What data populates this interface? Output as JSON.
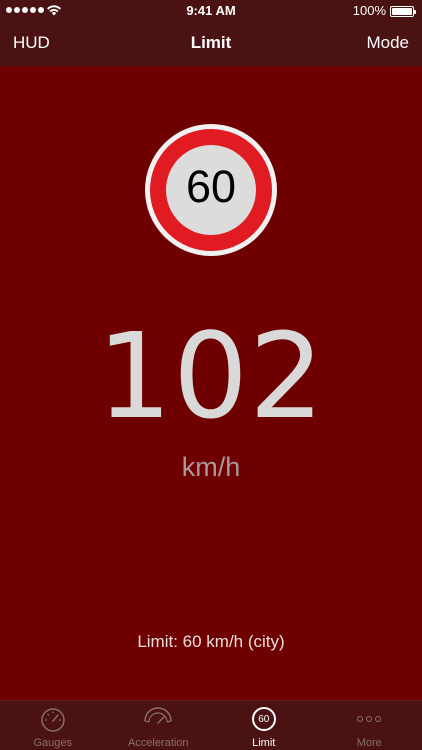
{
  "status_bar": {
    "time": "9:41 AM",
    "battery": "100%"
  },
  "nav": {
    "left": "HUD",
    "title": "Limit",
    "right": "Mode"
  },
  "main": {
    "sign_limit": "60",
    "speed": "102",
    "unit": "km/h",
    "limit_text": "Limit: 60 km/h (city)"
  },
  "tabs": [
    {
      "label": "Gauges",
      "icon": "gauge-icon",
      "active": false
    },
    {
      "label": "Acceleration",
      "icon": "acceleration-icon",
      "active": false
    },
    {
      "label": "Limit",
      "icon": "speed-limit-icon",
      "active": true,
      "icon_text": "60"
    },
    {
      "label": "More",
      "icon": "more-icon",
      "active": false
    }
  ],
  "colors": {
    "background": "#6e0000",
    "bars": "#4a1212",
    "sign_red": "#e01b22"
  }
}
